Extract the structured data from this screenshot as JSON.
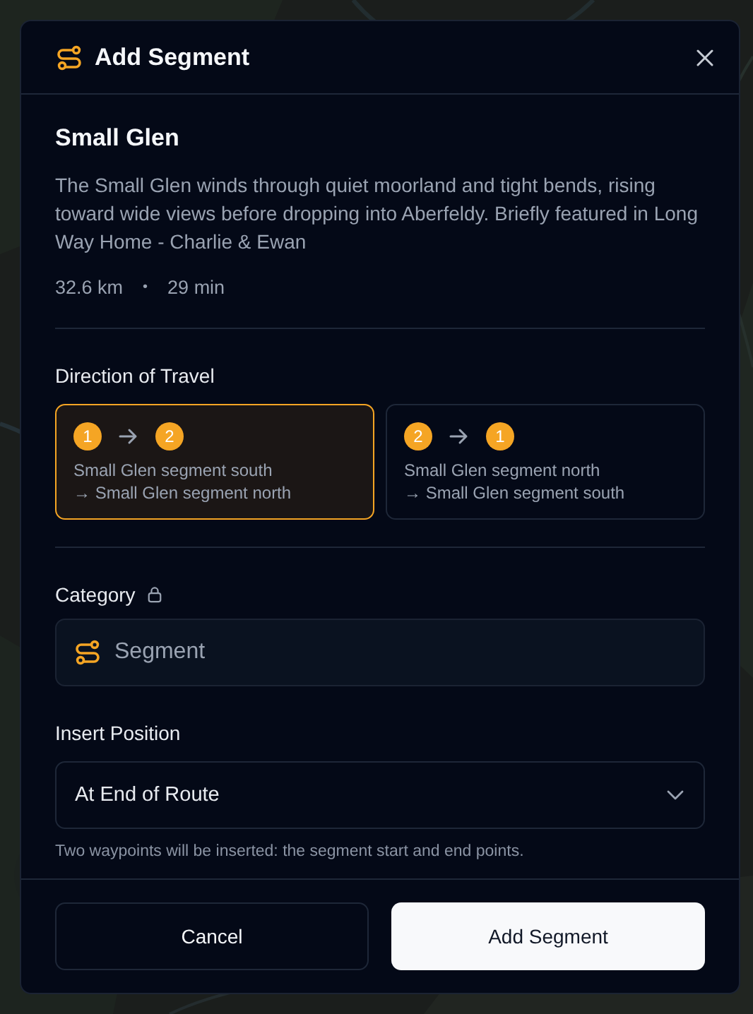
{
  "dialog": {
    "title": "Add Segment"
  },
  "segment": {
    "name": "Small Glen",
    "description": "The Small Glen winds through quiet moorland and tight bends, rising toward wide views before dropping into Aberfeldy. Briefly featured in Long Way Home - Charlie & Ewan",
    "distance": "32.6 km",
    "separator": "•",
    "duration": "29 min"
  },
  "direction": {
    "label": "Direction of Travel",
    "options": [
      {
        "from": "1",
        "to": "2",
        "start": "Small Glen segment south",
        "end": "→ Small Glen segment north",
        "selected": true
      },
      {
        "from": "2",
        "to": "1",
        "start": "Small Glen segment north",
        "end": "→ Small Glen segment south",
        "selected": false
      }
    ]
  },
  "category": {
    "label": "Category",
    "locked": true,
    "value": "Segment"
  },
  "insert_position": {
    "label": "Insert Position",
    "value": "At End of Route",
    "hint": "Two waypoints will be inserted: the segment start and end points."
  },
  "buttons": [
    {
      "label": "Cancel",
      "kind": "secondary"
    },
    {
      "label": "Add Segment",
      "kind": "primary"
    }
  ]
}
